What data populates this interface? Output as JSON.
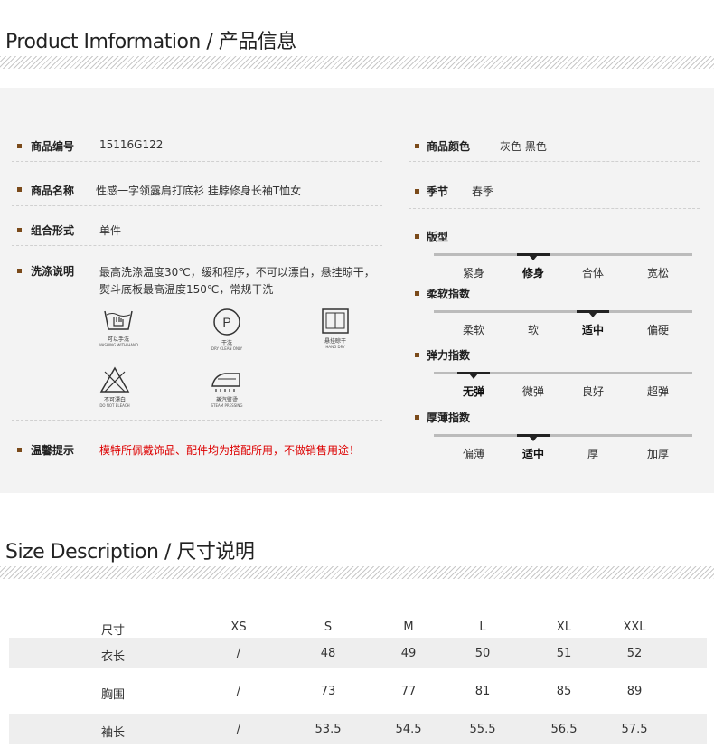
{
  "product_info": {
    "title": "Product Imformation / 产品信息"
  },
  "left": {
    "rows": [
      {
        "label": "商品编号",
        "value": "15116G122"
      },
      {
        "label": "商品名称",
        "value": "性感一字领露肩打底衫 挂脖修身长袖T恤女"
      },
      {
        "label": "组合形式",
        "value": "单件"
      },
      {
        "label": "洗涤说明",
        "value_line1": "最高洗涤温度30℃，缓和程序，不可以漂白，悬挂晾干，",
        "value_line2": "熨斗底板最高温度150℃，常规干洗"
      },
      {
        "label": "温馨提示",
        "value": "模特所佩戴饰品、配件均为搭配所用，不做销售用途！"
      }
    ],
    "wash_icons": [
      {
        "icon": "hand-wash-icon",
        "cap1": "可以手洗",
        "cap2": "WASHING WITH HAND"
      },
      {
        "icon": "dry-clean-icon",
        "cap1": "干洗",
        "cap2": "DRY CLEAN ONLY",
        "glyph": "P"
      },
      {
        "icon": "hang-dry-icon",
        "cap1": "悬挂晾干",
        "cap2": "HANG DRY"
      },
      {
        "icon": "no-bleach-icon",
        "cap1": "不可漂白",
        "cap2": "DO NOT BLEACH"
      },
      {
        "icon": "steam-iron-icon",
        "cap1": "蒸汽熨烫",
        "cap2": "STEAM PRESSING"
      }
    ]
  },
  "right": {
    "color": {
      "label": "商品颜色",
      "value": "灰色 黑色"
    },
    "season": {
      "label": "季节",
      "value": "春季"
    },
    "scales": [
      {
        "label": "版型",
        "options": [
          "紧身",
          "修身",
          "合体",
          "宽松"
        ],
        "selected": 1
      },
      {
        "label": "柔软指数",
        "options": [
          "柔软",
          "软",
          "适中",
          "偏硬"
        ],
        "selected": 2
      },
      {
        "label": "弹力指数",
        "options": [
          "无弹",
          "微弹",
          "良好",
          "超弹"
        ],
        "selected": 0
      },
      {
        "label": "厚薄指数",
        "options": [
          "偏薄",
          "适中",
          "厚",
          "加厚"
        ],
        "selected": 1
      }
    ],
    "bold_options": [
      [
        1
      ],
      [
        1
      ],
      [
        0
      ],
      [
        1
      ]
    ]
  },
  "size_desc": {
    "title": "Size Description / 尺寸说明",
    "headers": [
      "尺寸",
      "XS",
      "S",
      "M",
      "L",
      "XL",
      "XXL"
    ],
    "rows": [
      [
        "衣长",
        "/",
        "48",
        "49",
        "50",
        "51",
        "52"
      ],
      [
        "胸围",
        "/",
        "73",
        "77",
        "81",
        "85",
        "89"
      ],
      [
        "袖长",
        "/",
        "53.5",
        "54.5",
        "55.5",
        "56.5",
        "57.5"
      ]
    ]
  },
  "colors": {
    "bullet": "#7a4a1a",
    "warning": "#dd0000",
    "panel": "#f3f3f3"
  }
}
